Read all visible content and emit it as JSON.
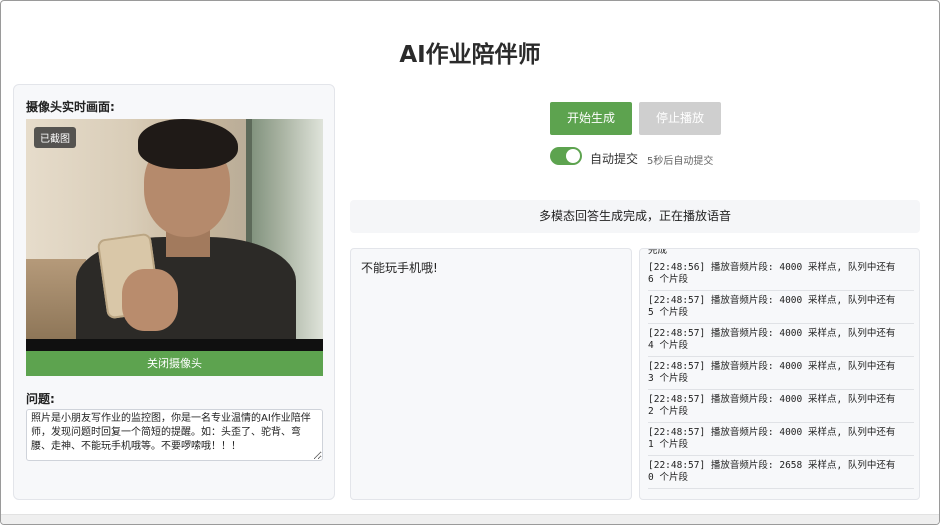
{
  "page": {
    "title": "AI作业陪伴师"
  },
  "camera": {
    "label": "摄像头实时画面:",
    "badge": "已截图",
    "close_button": "关闭摄像头"
  },
  "question": {
    "label": "问题:",
    "value": "照片是小朋友写作业的监控图，你是一名专业温情的AI作业陪伴师，发现问题时回复一个简短的提醒。如：头歪了、驼背、弯腰、走神、不能玩手机哦等。不要啰嗦哦！！！"
  },
  "controls": {
    "start_button": "开始生成",
    "stop_button": "停止播放",
    "auto_submit_label": "自动提交",
    "auto_submit_on": true,
    "auto_submit_hint": "5秒后自动提交"
  },
  "status": {
    "text": "多模态回答生成完成，正在播放语音"
  },
  "answer": {
    "text": "不能玩手机哦!"
  },
  "log": {
    "top_partial": "完成",
    "entries": [
      {
        "line1": "[22:48:56] 播放音频片段: 4000 采样点, 队列中还有",
        "line2": "6 个片段"
      },
      {
        "line1": "[22:48:57] 播放音频片段: 4000 采样点, 队列中还有",
        "line2": "5 个片段"
      },
      {
        "line1": "[22:48:57] 播放音频片段: 4000 采样点, 队列中还有",
        "line2": "4 个片段"
      },
      {
        "line1": "[22:48:57] 播放音频片段: 4000 采样点, 队列中还有",
        "line2": "3 个片段"
      },
      {
        "line1": "[22:48:57] 播放音频片段: 4000 采样点, 队列中还有",
        "line2": "2 个片段"
      },
      {
        "line1": "[22:48:57] 播放音频片段: 4000 采样点, 队列中还有",
        "line2": "1 个片段"
      },
      {
        "line1": "[22:48:57] 播放音频片段: 2658 采样点, 队列中还有",
        "line2": "0 个片段"
      }
    ]
  },
  "colors": {
    "accent": "#5da34f",
    "disabled": "#cfcfcf"
  }
}
